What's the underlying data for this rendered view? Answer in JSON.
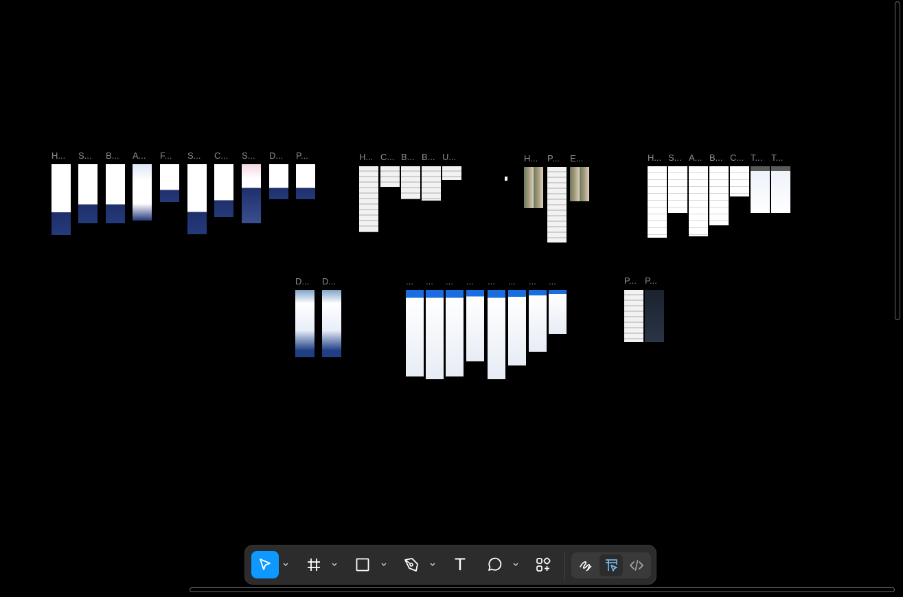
{
  "canvas": {
    "background": "#000000",
    "frames": [
      {
        "label": "H..."
      },
      {
        "label": "S..."
      },
      {
        "label": "B..."
      },
      {
        "label": "A..."
      },
      {
        "label": "F..."
      },
      {
        "label": "S..."
      },
      {
        "label": "C..."
      },
      {
        "label": "S..."
      },
      {
        "label": "D..."
      },
      {
        "label": "P..."
      },
      {
        "label": "H..."
      },
      {
        "label": "C..."
      },
      {
        "label": "B..."
      },
      {
        "label": "B..."
      },
      {
        "label": "U..."
      },
      {
        "label": "H..."
      },
      {
        "label": "P..."
      },
      {
        "label": "E..."
      },
      {
        "label": "H..."
      },
      {
        "label": "S..."
      },
      {
        "label": "A..."
      },
      {
        "label": "B..."
      },
      {
        "label": "C..."
      },
      {
        "label": "T..."
      },
      {
        "label": "T..."
      },
      {
        "label": "D..."
      },
      {
        "label": "D..."
      },
      {
        "label": "..."
      },
      {
        "label": "..."
      },
      {
        "label": "..."
      },
      {
        "label": "..."
      },
      {
        "label": "..."
      },
      {
        "label": "..."
      },
      {
        "label": "..."
      },
      {
        "label": "..."
      },
      {
        "label": "P..."
      },
      {
        "label": "P..."
      }
    ]
  },
  "toolbar": {
    "tools": [
      {
        "icon": "move-pointer-icon",
        "active": true
      },
      {
        "icon": "frame-hash-icon",
        "active": false
      },
      {
        "icon": "rectangle-icon",
        "active": false
      },
      {
        "icon": "pen-tool-icon",
        "active": false
      },
      {
        "icon": "text-icon",
        "glyph": "T",
        "active": false
      },
      {
        "icon": "comment-icon",
        "active": false
      },
      {
        "icon": "actions-grid-icon",
        "active": false
      }
    ],
    "modes": [
      {
        "icon": "draw-mode-icon",
        "selected": false
      },
      {
        "icon": "design-mode-icon",
        "selected": true
      },
      {
        "icon": "dev-mode-icon",
        "selected": false
      }
    ],
    "colors": {
      "accent": "#0d99ff",
      "toolbar_bg": "#2c2c2c",
      "icon": "#ffffff",
      "dev_icon": "#aaaaaa",
      "design_icon": "#7cc4fa"
    }
  }
}
